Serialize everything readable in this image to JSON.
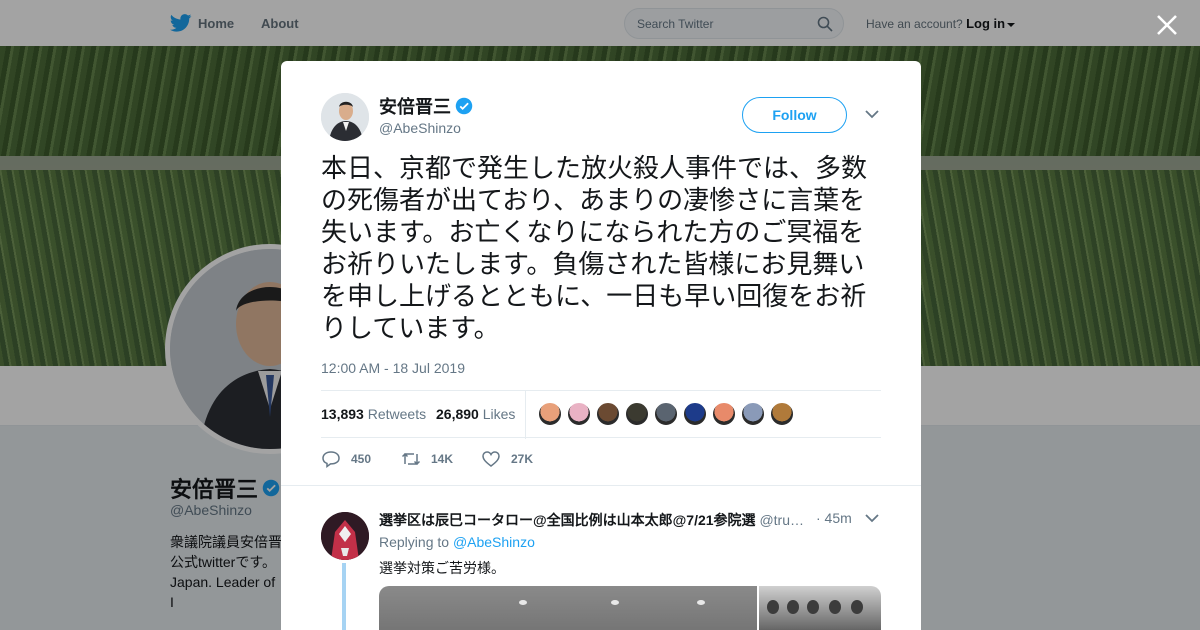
{
  "topnav": {
    "home_label": "Home",
    "about_label": "About",
    "search_placeholder": "Search Twitter",
    "account_prompt": "Have an account?",
    "login_label": "Log in"
  },
  "profile": {
    "name": "安倍晋三",
    "handle": "@AbeShinzo",
    "bio": "衆議院議員安倍晋\n公式twitterです。\nJapan. Leader of I\nParty."
  },
  "tweet": {
    "author_name": "安倍晋三",
    "author_handle": "@AbeShinzo",
    "follow_label": "Follow",
    "text": "本日、京都で発生した放火殺人事件では、多数の死傷者が出ており、あまりの凄惨さに言葉を失います。お亡くなりになられた方のご冥福をお祈りいたします。負傷された皆様にお見舞いを申し上げるとともに、一日も早い回復をお祈りしています。",
    "timestamp": "12:00 AM - 18 Jul 2019",
    "retweets_count": "13,893",
    "retweets_label": "Retweets",
    "likes_count": "26,890",
    "likes_label": "Likes",
    "liker_colors": [
      "#e8a07a",
      "#e9b2c4",
      "#6b4a32",
      "#3b3a30",
      "#5a6470",
      "#1d3b8a",
      "#e88a6a",
      "#8a9ab8",
      "#b07a3a"
    ],
    "reply_count": "450",
    "retweet_action_count": "14K",
    "like_action_count": "27K"
  },
  "reply": {
    "author_name": "選挙区は辰巳コータロー@全国比例は山本太郎@7/21参院選",
    "author_handle": "@tru…",
    "time": "· 45m",
    "replying_prefix": "Replying to",
    "replying_handle": "@AbeShinzo",
    "text": "選挙対策ご苦労様。"
  },
  "colors": {
    "accent": "#1da1f2",
    "text_primary": "#14171a",
    "text_secondary": "#657786"
  }
}
